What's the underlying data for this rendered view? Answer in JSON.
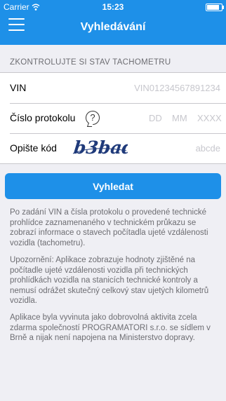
{
  "status_bar": {
    "carrier": "Carrier",
    "time": "15:23"
  },
  "header": {
    "title": "Vyhledávání"
  },
  "form": {
    "section_header": "ZKONTROLUJTE SI STAV TACHOMETRU",
    "vin_label": "VIN",
    "vin_placeholder": "VIN01234567891234",
    "protocol_label": "Číslo protokolu",
    "help_icon": "?",
    "day_placeholder": "DD",
    "month_placeholder": "MM",
    "year_placeholder": "XXXX",
    "captcha_label": "Opište kód",
    "captcha_text": "b3bad",
    "captcha_placeholder": "abcde"
  },
  "search_button": "Vyhledat",
  "info": {
    "p1": "Po zadání VIN a čísla protokolu o provedené technické prohlídce zaznamenaného v technickém průkazu se zobrazí informace o stavech počítadla ujeté vzdálenosti vozidla (tachometru).",
    "p2": "Upozornění: Aplikace zobrazuje hodnoty zjištěné na počítadle ujeté vzdálenosti vozidla při technických prohlídkách vozidla na stanicích technické kontroly a nemusí odrážet skutečný celkový stav ujetých kilometrů vozidla.",
    "p3": "Aplikace byla vyvinuta jako dobrovolná aktivita zcela zdarma společností PROGRAMATORI s.r.o. se sídlem v Brně a nijak není napojena na Ministerstvo dopravy."
  },
  "colors": {
    "accent": "#1e90e8",
    "background": "#efeff4"
  }
}
